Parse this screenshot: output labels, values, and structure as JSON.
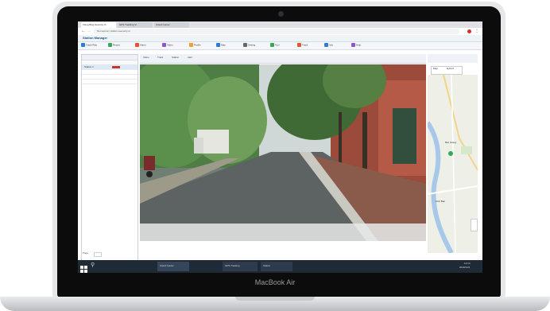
{
  "device": {
    "brand": "MacBook Air"
  },
  "browser": {
    "tabs": [
      {
        "label": "Vsing Bing Security Vi"
      },
      {
        "label": "GPS Tracking Vi"
      },
      {
        "label": "Cloud Center"
      }
    ],
    "url": "Not secure | station.vsecurity.vn"
  },
  "app": {
    "title": "Station Manager",
    "toolbar": [
      {
        "label": "Track Play",
        "icon": "play-icon",
        "color": "#2e7bd6"
      },
      {
        "label": "Report",
        "icon": "report-icon",
        "color": "#3aa757"
      },
      {
        "label": "Alarm",
        "icon": "alarm-icon",
        "color": "#e6542d"
      },
      {
        "label": "Video",
        "icon": "video-icon",
        "color": "#8c57c8"
      },
      {
        "label": "Profile",
        "icon": "user-icon",
        "color": "#f0a030"
      },
      {
        "label": "Map",
        "icon": "map-icon",
        "color": "#2e7bd6"
      },
      {
        "label": "Setting",
        "icon": "gear-icon",
        "color": "#666666"
      },
      {
        "label": "Tool",
        "icon": "tool-icon",
        "color": "#3aa757"
      },
      {
        "label": "Track",
        "icon": "track-icon",
        "color": "#e6542d"
      },
      {
        "label": "Info",
        "icon": "info-icon",
        "color": "#2e7bd6"
      },
      {
        "label": "Help",
        "icon": "help-icon",
        "color": "#8c57c8"
      }
    ],
    "left_panel": {
      "rows": [
        {
          "label": "Station 1"
        },
        {
          "label": ""
        },
        {
          "label": ""
        },
        {
          "label": ""
        }
      ],
      "footer": "Page"
    },
    "video": {
      "header_tabs": [
        "Video",
        "Track",
        "Station",
        "Alert"
      ]
    },
    "map": {
      "tabs": [
        "Map",
        "Hybrid"
      ],
      "labels": [
        "Bac Giang",
        "Kinh Bac"
      ]
    }
  },
  "taskbar": {
    "items": [
      {
        "label": "",
        "icon": "windows-icon"
      },
      {
        "label": "",
        "icon": "search-icon"
      },
      {
        "label": "Cloud Center",
        "icon": "app-icon"
      },
      {
        "label": "GPS Tracking",
        "icon": "chrome-icon"
      },
      {
        "label": "Station",
        "icon": "chrome-icon"
      }
    ],
    "clock": "12:14",
    "date": "2019/1/23"
  }
}
